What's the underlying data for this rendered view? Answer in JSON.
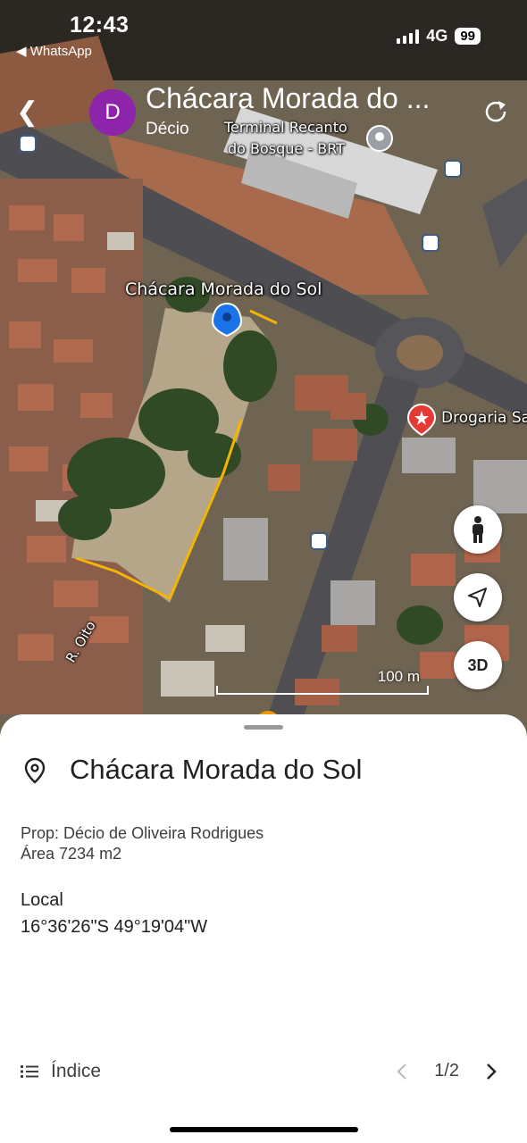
{
  "status": {
    "time": "12:43",
    "back_app": "◀ WhatsApp",
    "network": "4G",
    "battery": "99"
  },
  "header": {
    "avatar_letter": "D",
    "title": "Chácara Morada do ...",
    "subtitle": "Décio"
  },
  "map": {
    "labels": {
      "terminal_line1": "Terminal Recanto",
      "terminal_line2": "do Bosque - BRT",
      "place": "Chácara Morada do Sol",
      "store": "Drogaria Sa",
      "street": "R. Oito"
    },
    "scale": "100 m",
    "buttons": {
      "three_d": "3D"
    },
    "colors": {
      "boundary": "#f4b400",
      "pin": "#1a73e8",
      "store_pin": "#e53935"
    }
  },
  "sheet": {
    "title": "Chácara Morada do Sol",
    "desc_line1": "Prop: Décio de Oliveira Rodrigues",
    "desc_line2": "Área 7234 m2",
    "local_title": "Local",
    "local_value": "16°36'26\"S 49°19'04\"W",
    "index_label": "Índice",
    "pager": "1/2"
  }
}
